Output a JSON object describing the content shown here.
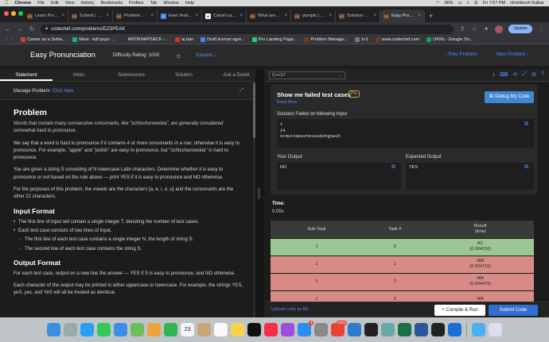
{
  "menubar": {
    "app": "Chrome",
    "items": [
      "File",
      "Edit",
      "View",
      "History",
      "Bookmarks",
      "Profiles",
      "Tab",
      "Window",
      "Help"
    ],
    "battery": "96%",
    "clock": "Fri 7:57 PM",
    "user": "Hrishikesh Kalkar"
  },
  "tabs": [
    {
      "title": "Learn Programming",
      "color": "#6a3c1f",
      "fav": "CC"
    },
    {
      "title": "Submit | CodeChef",
      "color": "#6a3c1f",
      "fav": "CC"
    },
    {
      "title": "Problem Manageme...",
      "color": "#6a3c1f",
      "fav": "CC"
    },
    {
      "title": "learn feedback - Go...",
      "color": "#4285f4",
      "fav": "G"
    },
    {
      "title": "Camel case - Wikip...",
      "color": "#fff",
      "fav": "W"
    },
    {
      "title": "What are the failed",
      "color": "#6a3c1f",
      "fav": "CC"
    },
    {
      "title": "pumpin | CodeChef",
      "color": "#6a3c1f",
      "fav": "CC"
    },
    {
      "title": "Solution: 8320730...",
      "color": "#6a3c1f",
      "fav": "CC"
    },
    {
      "title": "Easy Pronunciation",
      "color": "#6a3c1f",
      "fav": "CC",
      "active": true
    }
  ],
  "address": {
    "url": "codechef.com/problems/EZSPEAK",
    "update_label": "Update"
  },
  "bookmarks": [
    {
      "label": "Career as a Softw...",
      "color": "#b44"
    },
    {
      "label": "Meet - kdf-pcpz-...",
      "color": "#2a8"
    },
    {
      "label": "ANTIKNAPSACK -...",
      "color": "#333"
    },
    {
      "label": "aj ban",
      "color": "#c33"
    },
    {
      "label": "Draft license agre...",
      "color": "#4285f4"
    },
    {
      "label": "Pro Landing Page...",
      "color": "#2c7"
    },
    {
      "label": "Problem Manage...",
      "color": "#6a3c1f"
    },
    {
      "label": "1v1",
      "color": "#777"
    },
    {
      "label": "www.codechef.com",
      "color": "#6a3c1f"
    },
    {
      "label": "OKRs - Google Sh...",
      "color": "#0f9d58"
    }
  ],
  "header": {
    "title": "Easy Pronunciation",
    "difficulty": "Difficulty Rating: 1000",
    "expand": "Expand",
    "prev": "Prev Problem",
    "next": "Next Problem"
  },
  "left_tabs": [
    "Statement",
    "Hints",
    "Submissions",
    "Solution",
    "Ask a Doubt"
  ],
  "manage": {
    "label": "Manage Problem",
    "link": "Click here"
  },
  "problem": {
    "title": "Problem",
    "intro": "Words that contain many consecutive consonants, like \"schtschurowskia\", are generally considered somewhat hard to pronounce.",
    "p1": "We say that a word is hard to pronounce if it contains 4 or more consonants in a row; otherwise it is easy to pronounce. For example, \"apple\" and \"polish\" are easy to pronounce, but \"schtschurowskia\" is hard to pronounce.",
    "p2": "You are given a string S consisting of N lowercase Latin characters. Determine whether it is easy to pronounce or not based on the rule above — print YES if it is easy to pronounce and NO otherwise.",
    "p3": "For the purposes of this problem, the vowels are the characters {a, e, i, o, u} and the consonants are the other 21 characters.",
    "input_title": "Input Format",
    "input_items": [
      "The first line of input will contain a single integer T, denoting the number of test cases.",
      "Each test case consists of two lines of input."
    ],
    "input_sub": [
      "The first line of each test case contains a single integer N, the length of string S.",
      "The second line of each test case contains the string S."
    ],
    "output_title": "Output Format",
    "out1": "For each test case, output on a new line the answer — YES if S is easy to pronounce, and NO otherwise.",
    "out2": "Each character of the output may be printed in either uppercase or lowercase. For example, the strings YES, yeS, yes, and YeS will all be treated as identical."
  },
  "editor": {
    "language": "C++17"
  },
  "failed": {
    "title": "Show me failed test cases",
    "pro": "Pro",
    "know_more": "Know More",
    "debug": "Debug My Code",
    "solution_label": "Solution Failed on following Input",
    "input": "1\n24\nocmutxqeeznsuxakohgowih",
    "your_output_label": "Your Output",
    "your_output": "NO",
    "expected_label": "Expected Output",
    "expected": "YES"
  },
  "time": {
    "label": "Time:",
    "value": "0.00s"
  },
  "table": {
    "headers": [
      "Sub-Task",
      "Task #",
      "Result\n(time)"
    ],
    "rows": [
      {
        "subtask": "1",
        "task": "0",
        "result": "AC",
        "time": "(0.004216)",
        "status": "ac"
      },
      {
        "subtask": "1",
        "task": "1",
        "result": "WA",
        "time": "(0.004715)",
        "status": "wa"
      },
      {
        "subtask": "1",
        "task": "2",
        "result": "WA",
        "time": "(0.004479)",
        "status": "wa"
      },
      {
        "subtask": "1",
        "task": "3",
        "result": "WA",
        "time": "",
        "status": "wa"
      }
    ]
  },
  "bottom": {
    "upload": "Upload code as file",
    "compile": "+ Compile & Run",
    "submit": "Submit Code"
  },
  "dock": [
    {
      "name": "finder",
      "color": "#3b8fe0"
    },
    {
      "name": "launchpad",
      "color": "#9aa"
    },
    {
      "name": "safari",
      "color": "#2a9df4"
    },
    {
      "name": "messages",
      "color": "#34c759"
    },
    {
      "name": "mail",
      "color": "#3a8ee6"
    },
    {
      "name": "maps",
      "color": "#6bbf59"
    },
    {
      "name": "photos",
      "color": "#f0a23b"
    },
    {
      "name": "facetime",
      "color": "#2fb84f"
    },
    {
      "name": "calendar",
      "color": "#f4f4f4",
      "label": "23"
    },
    {
      "name": "contacts",
      "color": "#c7a77a"
    },
    {
      "name": "reminders",
      "color": "#f9f9f9"
    },
    {
      "name": "notes",
      "color": "#f7d44a"
    },
    {
      "name": "tv",
      "color": "#111"
    },
    {
      "name": "music",
      "color": "#fa2d48"
    },
    {
      "name": "podcasts",
      "color": "#9b4ddb"
    },
    {
      "name": "appstore",
      "color": "#2d8cf0",
      "badge": "4"
    },
    {
      "name": "settings",
      "color": "#888"
    },
    {
      "name": "chrome",
      "color": "#ea4335",
      "badge": "1001"
    },
    {
      "name": "vscode",
      "color": "#2b7ccf"
    },
    {
      "name": "piano",
      "color": "#222"
    },
    {
      "name": "preview",
      "color": "#6aa"
    },
    {
      "name": "excel",
      "color": "#1d7044"
    },
    {
      "name": "word",
      "color": "#2b579a"
    },
    {
      "name": "terminal",
      "color": "#222"
    },
    {
      "name": "xcode",
      "color": "#1b6fd9"
    },
    {
      "name": "downloads",
      "color": "#4ab0f0"
    },
    {
      "name": "trash",
      "color": "#dde"
    }
  ]
}
